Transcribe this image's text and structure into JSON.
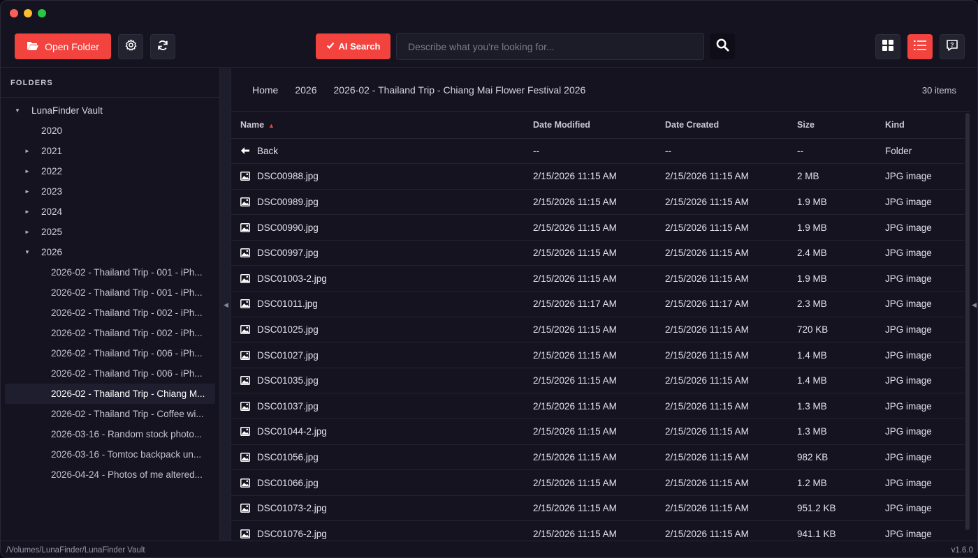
{
  "toolbar": {
    "open_folder_label": "Open Folder",
    "ai_search_label": "AI Search",
    "search_placeholder": "Describe what you're looking for...",
    "accent_color": "#f2433f"
  },
  "sidebar": {
    "header": "FOLDERS",
    "root": "LunaFinder Vault",
    "years": [
      {
        "label": "2020",
        "arrow": ""
      },
      {
        "label": "2021",
        "arrow": "►"
      },
      {
        "label": "2022",
        "arrow": "►"
      },
      {
        "label": "2023",
        "arrow": "►"
      },
      {
        "label": "2024",
        "arrow": "►"
      },
      {
        "label": "2025",
        "arrow": "►"
      },
      {
        "label": "2026",
        "arrow": "▼"
      }
    ],
    "subfolders": [
      "2026-02 - Thailand Trip - 001 - iPh...",
      "2026-02 - Thailand Trip - 001 - iPh...",
      "2026-02 - Thailand Trip - 002 - iPh...",
      "2026-02 - Thailand Trip - 002 - iPh...",
      "2026-02 - Thailand Trip - 006 - iPh...",
      "2026-02 - Thailand Trip - 006 - iPh...",
      "2026-02 - Thailand Trip - Chiang M...",
      "2026-02 - Thailand Trip - Coffee wi...",
      "2026-03-16 - Random stock photo...",
      "2026-03-16 - Tomtoc backpack un...",
      "2026-04-24 - Photos of me altered..."
    ],
    "selected_index": 6
  },
  "breadcrumb": [
    "Home",
    "2026",
    "2026-02 - Thailand Trip - Chiang Mai Flower Festival 2026"
  ],
  "item_count": "30 items",
  "table": {
    "headers": [
      "Name",
      "Date Modified",
      "Date Created",
      "Size",
      "Kind"
    ],
    "sort_indicator": "▲",
    "rows": [
      {
        "icon": "back-arrow-icon",
        "name": "Back",
        "modified": "--",
        "created": "--",
        "size": "--",
        "kind": "Folder"
      },
      {
        "icon": "image-icon",
        "name": "DSC00988.jpg",
        "modified": "2/15/2026 11:15 AM",
        "created": "2/15/2026 11:15 AM",
        "size": "2 MB",
        "kind": "JPG image"
      },
      {
        "icon": "image-icon",
        "name": "DSC00989.jpg",
        "modified": "2/15/2026 11:15 AM",
        "created": "2/15/2026 11:15 AM",
        "size": "1.9 MB",
        "kind": "JPG image"
      },
      {
        "icon": "image-icon",
        "name": "DSC00990.jpg",
        "modified": "2/15/2026 11:15 AM",
        "created": "2/15/2026 11:15 AM",
        "size": "1.9 MB",
        "kind": "JPG image"
      },
      {
        "icon": "image-icon",
        "name": "DSC00997.jpg",
        "modified": "2/15/2026 11:15 AM",
        "created": "2/15/2026 11:15 AM",
        "size": "2.4 MB",
        "kind": "JPG image"
      },
      {
        "icon": "image-icon",
        "name": "DSC01003-2.jpg",
        "modified": "2/15/2026 11:15 AM",
        "created": "2/15/2026 11:15 AM",
        "size": "1.9 MB",
        "kind": "JPG image"
      },
      {
        "icon": "image-icon",
        "name": "DSC01011.jpg",
        "modified": "2/15/2026 11:17 AM",
        "created": "2/15/2026 11:17 AM",
        "size": "2.3 MB",
        "kind": "JPG image"
      },
      {
        "icon": "image-icon",
        "name": "DSC01025.jpg",
        "modified": "2/15/2026 11:15 AM",
        "created": "2/15/2026 11:15 AM",
        "size": "720 KB",
        "kind": "JPG image"
      },
      {
        "icon": "image-icon",
        "name": "DSC01027.jpg",
        "modified": "2/15/2026 11:15 AM",
        "created": "2/15/2026 11:15 AM",
        "size": "1.4 MB",
        "kind": "JPG image"
      },
      {
        "icon": "image-icon",
        "name": "DSC01035.jpg",
        "modified": "2/15/2026 11:15 AM",
        "created": "2/15/2026 11:15 AM",
        "size": "1.4 MB",
        "kind": "JPG image"
      },
      {
        "icon": "image-icon",
        "name": "DSC01037.jpg",
        "modified": "2/15/2026 11:15 AM",
        "created": "2/15/2026 11:15 AM",
        "size": "1.3 MB",
        "kind": "JPG image"
      },
      {
        "icon": "image-icon",
        "name": "DSC01044-2.jpg",
        "modified": "2/15/2026 11:15 AM",
        "created": "2/15/2026 11:15 AM",
        "size": "1.3 MB",
        "kind": "JPG image"
      },
      {
        "icon": "image-icon",
        "name": "DSC01056.jpg",
        "modified": "2/15/2026 11:15 AM",
        "created": "2/15/2026 11:15 AM",
        "size": "982 KB",
        "kind": "JPG image"
      },
      {
        "icon": "image-icon",
        "name": "DSC01066.jpg",
        "modified": "2/15/2026 11:15 AM",
        "created": "2/15/2026 11:15 AM",
        "size": "1.2 MB",
        "kind": "JPG image"
      },
      {
        "icon": "image-icon",
        "name": "DSC01073-2.jpg",
        "modified": "2/15/2026 11:15 AM",
        "created": "2/15/2026 11:15 AM",
        "size": "951.2 KB",
        "kind": "JPG image"
      },
      {
        "icon": "image-icon",
        "name": "DSC01076-2.jpg",
        "modified": "2/15/2026 11:15 AM",
        "created": "2/15/2026 11:15 AM",
        "size": "941.1 KB",
        "kind": "JPG image"
      }
    ]
  },
  "status": {
    "path": "/Volumes/LunaFinder/LunaFinder Vault",
    "version": "v1.6.0"
  }
}
